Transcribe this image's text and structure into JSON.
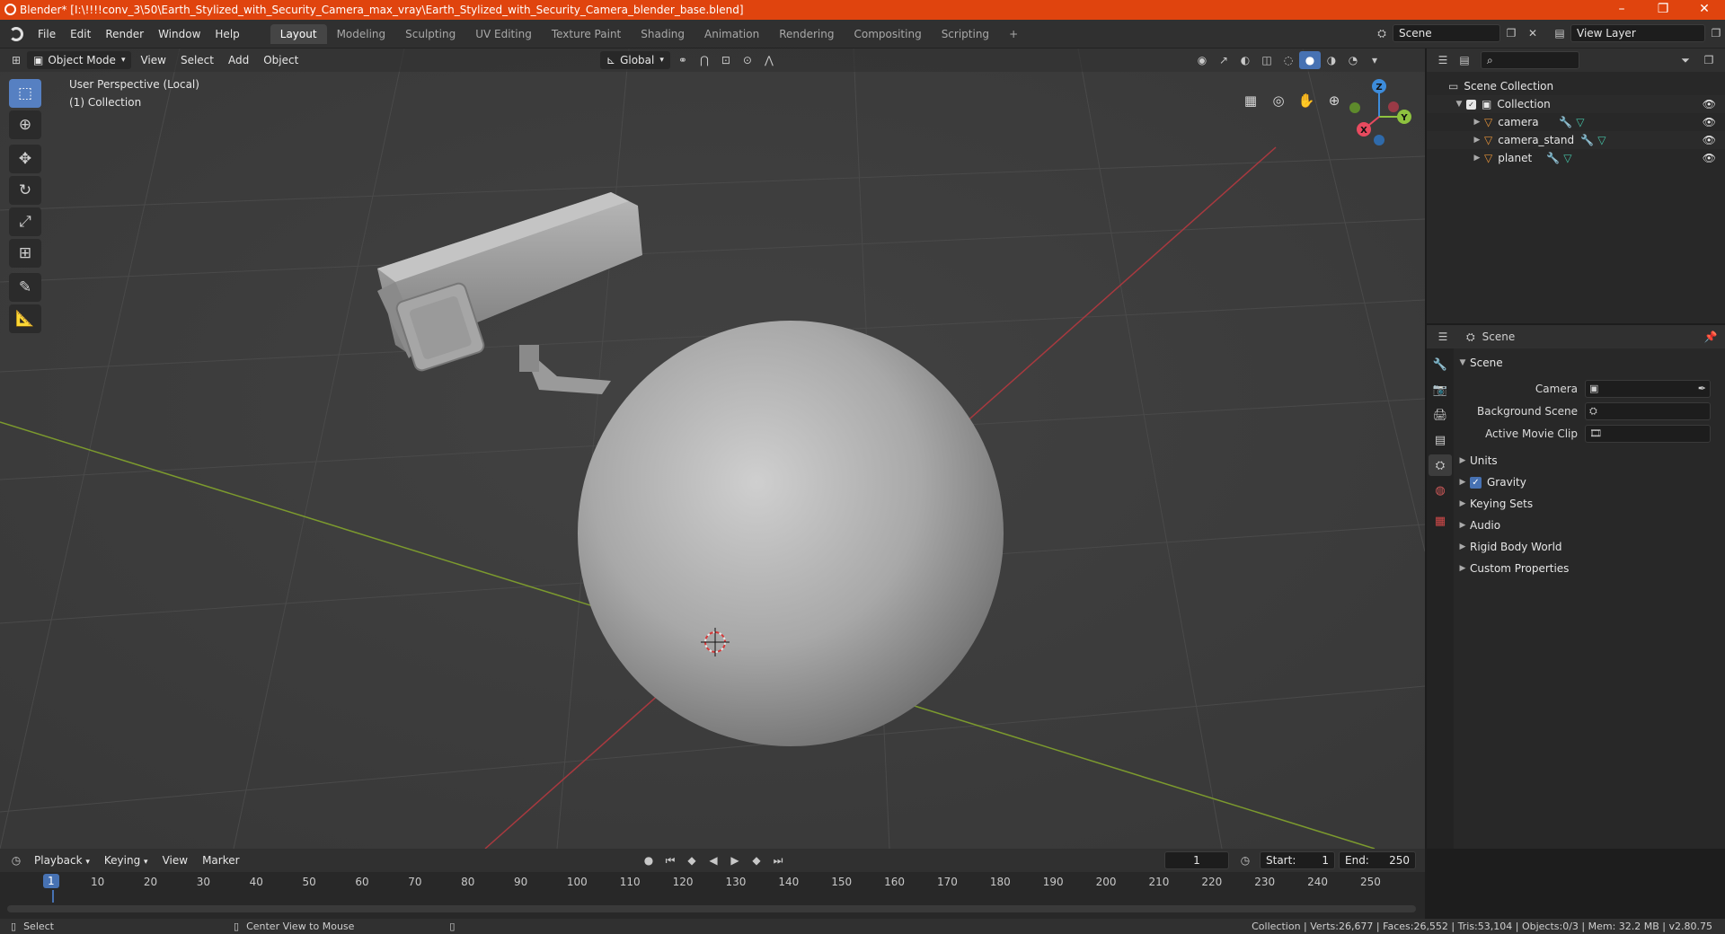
{
  "window": {
    "title": "Blender* [I:\\!!!!conv_3\\50\\Earth_Stylized_with_Security_Camera_max_vray\\Earth_Stylized_with_Security_Camera_blender_base.blend]",
    "minimize": "–",
    "maximize": "❐",
    "close": "✕"
  },
  "menu": {
    "file": "File",
    "edit": "Edit",
    "render": "Render",
    "window": "Window",
    "help": "Help"
  },
  "workspaces": [
    "Layout",
    "Modeling",
    "Sculpting",
    "UV Editing",
    "Texture Paint",
    "Shading",
    "Animation",
    "Rendering",
    "Compositing",
    "Scripting"
  ],
  "add_workspace": "+",
  "scene_selector": {
    "value": "Scene"
  },
  "view_layer_selector": {
    "value": "View Layer"
  },
  "viewport": {
    "mode": "Object Mode",
    "menus": {
      "view": "View",
      "select": "Select",
      "add": "Add",
      "object": "Object"
    },
    "orientation": "Global",
    "info_line1": "User Perspective (Local)",
    "info_line2": "(1) Collection",
    "gizmo": {
      "x": "X",
      "y": "Y",
      "z": "Z"
    }
  },
  "outliner": {
    "scene_collection": "Scene Collection",
    "collection": "Collection",
    "objects": [
      "camera",
      "camera_stand",
      "planet"
    ]
  },
  "properties": {
    "context": "Scene",
    "panel_title": "Scene",
    "camera_label": "Camera",
    "background_scene_label": "Background Scene",
    "active_movie_clip_label": "Active Movie Clip",
    "sections": {
      "units": "Units",
      "gravity": "Gravity",
      "keying_sets": "Keying Sets",
      "audio": "Audio",
      "rigid_body_world": "Rigid Body World",
      "custom_properties": "Custom Properties"
    }
  },
  "timeline": {
    "playback": "Playback",
    "keying": "Keying",
    "view": "View",
    "marker": "Marker",
    "current_frame": "1",
    "start_label": "Start:",
    "start_value": "1",
    "end_label": "End:",
    "end_value": "250",
    "ticks": [
      "10",
      "20",
      "30",
      "40",
      "50",
      "60",
      "70",
      "80",
      "90",
      "100",
      "110",
      "120",
      "130",
      "140",
      "150",
      "160",
      "170",
      "180",
      "190",
      "200",
      "210",
      "220",
      "230",
      "240",
      "250"
    ]
  },
  "statusbar": {
    "select": "Select",
    "center_view": "Center View to Mouse",
    "stats": "Collection | Verts:26,677 | Faces:26,552 | Tris:53,104 | Objects:0/3 | Mem: 32.2 MB | v2.80.75"
  },
  "colors": {
    "accent": "#4772b3",
    "titlebar": "#e0440e",
    "x_axis": "#e84a5f",
    "y_axis": "#8ec23f",
    "z_axis": "#3d8cdb"
  }
}
